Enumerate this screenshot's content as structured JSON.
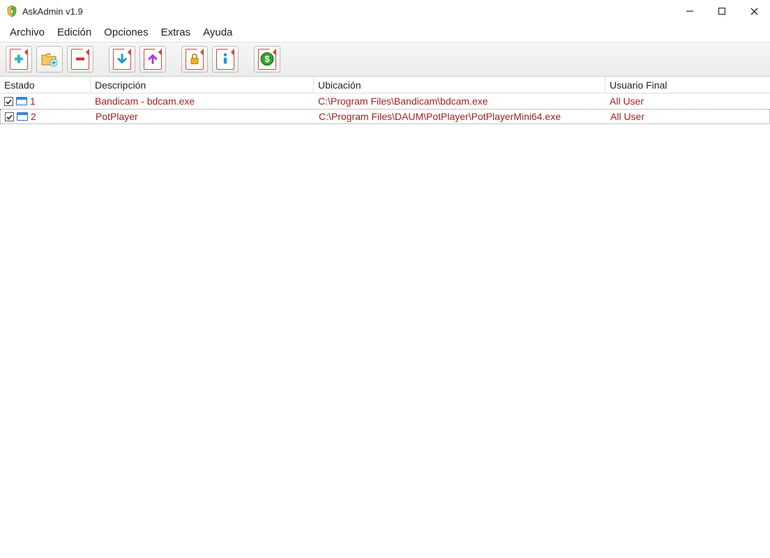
{
  "window": {
    "title": "AskAdmin v1.9"
  },
  "menubar": {
    "archivo": "Archivo",
    "edicion": "Edición",
    "opciones": "Opciones",
    "extras": "Extras",
    "ayuda": "Ayuda"
  },
  "columns": {
    "estado": "Estado",
    "descripcion": "Descripción",
    "ubicacion": "Ubicación",
    "usuario_final": "Usuario Final"
  },
  "rows": [
    {
      "checked": true,
      "index": "1",
      "descripcion": "Bandicam - bdcam.exe",
      "ubicacion": "C:\\Program Files\\Bandicam\\bdcam.exe",
      "usuario": "All User",
      "selected": false
    },
    {
      "checked": true,
      "index": "2",
      "descripcion": "PotPlayer",
      "ubicacion": "C:\\Program Files\\DAUM\\PotPlayer\\PotPlayerMini64.exe",
      "usuario": "All User",
      "selected": true
    }
  ],
  "colors": {
    "row_text": "#a02020"
  }
}
